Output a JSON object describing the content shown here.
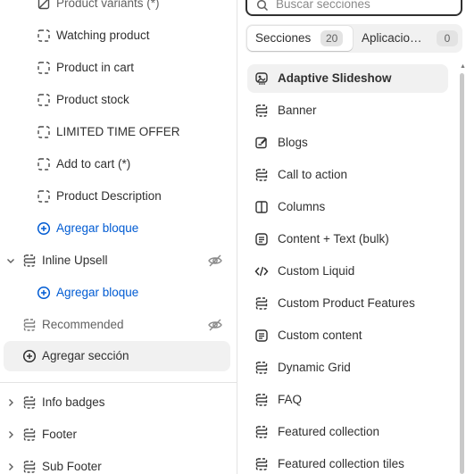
{
  "tree": {
    "rows": [
      {
        "label": "Product variants (*)",
        "icon": "hidden-block-icon"
      },
      {
        "label": "Watching product",
        "icon": "block-dashed-icon"
      },
      {
        "label": "Product in cart",
        "icon": "block-dashed-icon"
      },
      {
        "label": "Product stock",
        "icon": "block-dashed-icon"
      },
      {
        "label": "LIMITED TIME OFFER",
        "icon": "block-dashed-icon"
      },
      {
        "label": "Add to cart (*)",
        "icon": "block-dashed-icon"
      },
      {
        "label": "Product Description",
        "icon": "block-dashed-icon"
      },
      {
        "label": "Agregar bloque",
        "icon": "plus-circle-icon"
      },
      {
        "label": "Inline Upsell",
        "icon": "section-icon"
      },
      {
        "label": "Agregar bloque",
        "icon": "plus-circle-icon"
      },
      {
        "label": "Recommended",
        "icon": "section-icon"
      },
      {
        "label": "Agregar sección",
        "icon": "plus-circle-icon"
      },
      {
        "label": "Info badges",
        "icon": "section-icon"
      },
      {
        "label": "Footer",
        "icon": "section-icon"
      },
      {
        "label": "Sub Footer",
        "icon": "section-icon"
      }
    ]
  },
  "picker": {
    "search_placeholder": "Buscar secciones",
    "tabs": [
      {
        "label": "Secciones",
        "count": "20"
      },
      {
        "label": "Aplicacio…",
        "count": "0"
      }
    ],
    "items": [
      {
        "label": "Adaptive Slideshow",
        "icon": "slideshow-icon",
        "selected": true
      },
      {
        "label": "Banner",
        "icon": "section-icon"
      },
      {
        "label": "Blogs",
        "icon": "blog-edit-icon"
      },
      {
        "label": "Call to action",
        "icon": "section-icon"
      },
      {
        "label": "Columns",
        "icon": "columns-icon"
      },
      {
        "label": "Content + Text (bulk)",
        "icon": "text-block-icon"
      },
      {
        "label": "Custom Liquid",
        "icon": "code-icon"
      },
      {
        "label": "Custom Product Features",
        "icon": "section-icon"
      },
      {
        "label": "Custom content",
        "icon": "text-block-icon"
      },
      {
        "label": "Dynamic Grid",
        "icon": "section-icon"
      },
      {
        "label": "FAQ",
        "icon": "section-icon"
      },
      {
        "label": "Featured collection",
        "icon": "section-icon"
      },
      {
        "label": "Featured collection tiles",
        "icon": "section-icon"
      }
    ]
  },
  "colors": {
    "accent": "#005bd3",
    "selected_bg": "#f1f1f1",
    "text": "#303030",
    "muted": "#616161"
  }
}
